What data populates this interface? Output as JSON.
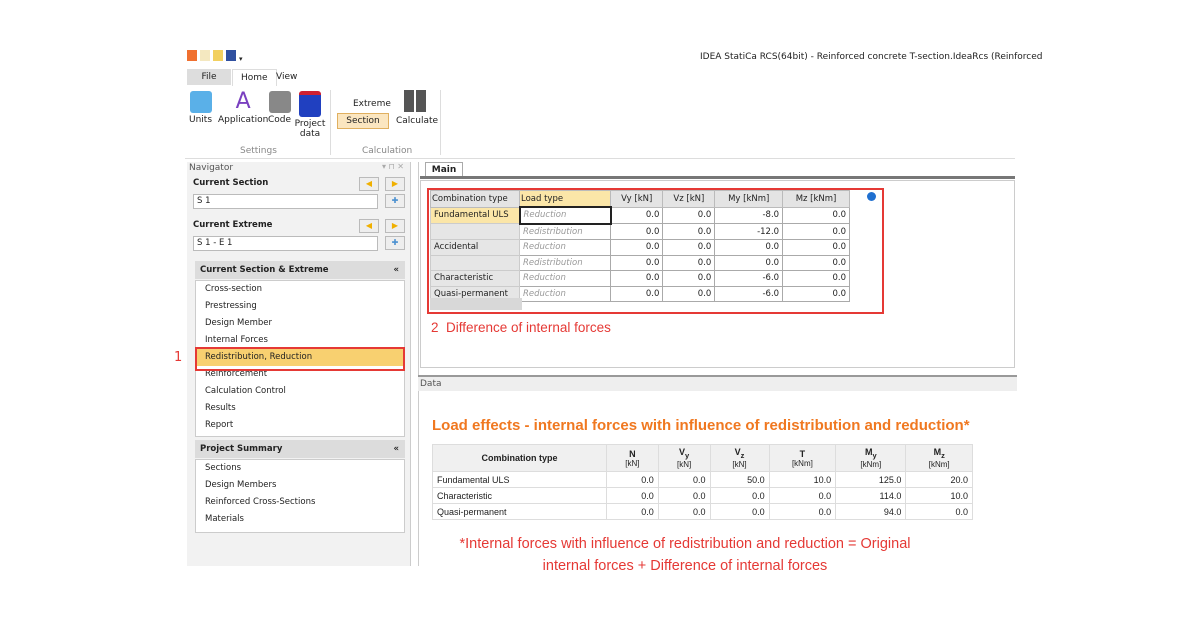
{
  "window": {
    "title": "IDEA StatiCa RCS(64bit) - Reinforced concrete T-section.IdeaRcs (Reinforced"
  },
  "ribbon": {
    "tabs": [
      "File",
      "Home",
      "View"
    ],
    "settings": {
      "label": "Settings",
      "buttons": [
        "Units",
        "Application",
        "Code",
        "Project data"
      ]
    },
    "calculation": {
      "label": "Calculation",
      "extreme": "Extreme",
      "section": "Section",
      "calculate": "Calculate"
    }
  },
  "navigator": {
    "title": "Navigator",
    "current_section_label": "Current Section",
    "current_section": "S 1",
    "current_extreme_label": "Current Extreme",
    "current_extreme": "S 1 - E 1",
    "cse_header": "Current Section & Extreme",
    "cse_items": [
      "Cross-section",
      "Prestressing",
      "Design Member",
      "Internal Forces",
      "Redistribution, Reduction",
      "Reinforcement",
      "Calculation Control",
      "Results",
      "Report"
    ],
    "ps_header": "Project Summary",
    "ps_items": [
      "Sections",
      "Design Members",
      "Reinforced Cross-Sections",
      "Materials"
    ]
  },
  "main": {
    "tab": "Main",
    "headers": [
      "Combination type",
      "Load type",
      "Vy [kN]",
      "Vz [kN]",
      "My [kNm]",
      "Mz [kNm]"
    ],
    "rows": [
      [
        "Fundamental ULS",
        "Reduction",
        "0.0",
        "0.0",
        "-8.0",
        "0.0"
      ],
      [
        "",
        "Redistribution",
        "0.0",
        "0.0",
        "-12.0",
        "0.0"
      ],
      [
        "Accidental",
        "Reduction",
        "0.0",
        "0.0",
        "0.0",
        "0.0"
      ],
      [
        "",
        "Redistribution",
        "0.0",
        "0.0",
        "0.0",
        "0.0"
      ],
      [
        "Characteristic",
        "Reduction",
        "0.0",
        "0.0",
        "-6.0",
        "0.0"
      ],
      [
        "Quasi-permanent",
        "Reduction",
        "0.0",
        "0.0",
        "-6.0",
        "0.0"
      ]
    ]
  },
  "data": {
    "panel": "Data",
    "title": "Load effects - internal forces with influence of redistribution and reduction",
    "asterisk": "*",
    "headers": [
      {
        "n": "Combination type",
        "s": "",
        "u": ""
      },
      {
        "n": "N",
        "s": "",
        "u": "[kN]"
      },
      {
        "n": "V",
        "s": "y",
        "u": "[kN]"
      },
      {
        "n": "V",
        "s": "z",
        "u": "[kN]"
      },
      {
        "n": "T",
        "s": "",
        "u": "[kNm]"
      },
      {
        "n": "M",
        "s": "y",
        "u": "[kNm]"
      },
      {
        "n": "M",
        "s": "z",
        "u": "[kNm]"
      }
    ],
    "rows": [
      [
        "Fundamental ULS",
        "0.0",
        "0.0",
        "50.0",
        "10.0",
        "125.0",
        "20.0"
      ],
      [
        "Characteristic",
        "0.0",
        "0.0",
        "0.0",
        "0.0",
        "114.0",
        "10.0"
      ],
      [
        "Quasi-permanent",
        "0.0",
        "0.0",
        "0.0",
        "0.0",
        "94.0",
        "0.0"
      ]
    ]
  },
  "annotations": {
    "one": "1",
    "two": "2  Difference of internal forces",
    "footnote1": "*Internal forces with influence of redistribution and reduction = Original",
    "footnote2": "internal forces + Difference of internal forces"
  },
  "colors": {
    "highlight": "#e53935",
    "orange": "#f07820"
  }
}
